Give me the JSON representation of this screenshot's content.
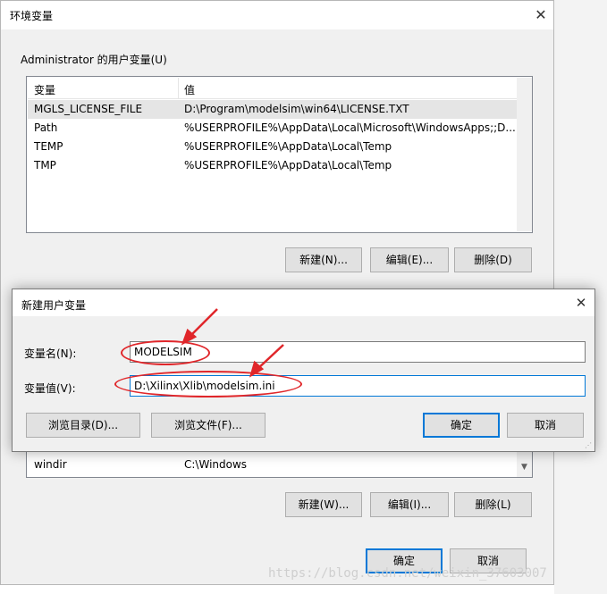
{
  "env_window": {
    "title": "环境变量",
    "close_glyph": "✕",
    "user_group_label": "Administrator 的用户变量(U)",
    "columns": [
      "变量",
      "值"
    ],
    "user_vars": [
      {
        "name": "MGLS_LICENSE_FILE",
        "value": "D:\\Program\\modelsim\\win64\\LICENSE.TXT"
      },
      {
        "name": "Path",
        "value": "%USERPROFILE%\\AppData\\Local\\Microsoft\\WindowsApps;;D..."
      },
      {
        "name": "TEMP",
        "value": "%USERPROFILE%\\AppData\\Local\\Temp"
      },
      {
        "name": "TMP",
        "value": "%USERPROFILE%\\AppData\\Local\\Temp"
      }
    ],
    "user_buttons": {
      "new": "新建(N)...",
      "edit": "编辑(E)...",
      "delete": "删除(D)"
    },
    "sys_vars": [
      {
        "name": "windir",
        "value": "C:\\Windows"
      }
    ],
    "sys_buttons": {
      "new": "新建(W)...",
      "edit": "编辑(I)...",
      "delete": "删除(L)"
    },
    "footer_buttons": {
      "ok": "确定",
      "cancel": "取消"
    }
  },
  "dialog": {
    "title": "新建用户变量",
    "close_glyph": "✕",
    "name_label": "变量名(N):",
    "name_value": "MODELSIM",
    "value_label": "变量值(V):",
    "value_value": "D:\\Xilinx\\Xlib\\modelsim.ini",
    "browse_dir": "浏览目录(D)...",
    "browse_file": "浏览文件(F)...",
    "ok": "确定",
    "cancel": "取消"
  },
  "watermark": "https://blog.csdn.net/weixin_37603007",
  "colors": {
    "annotation": "#e0262a",
    "accent": "#0078d7"
  }
}
